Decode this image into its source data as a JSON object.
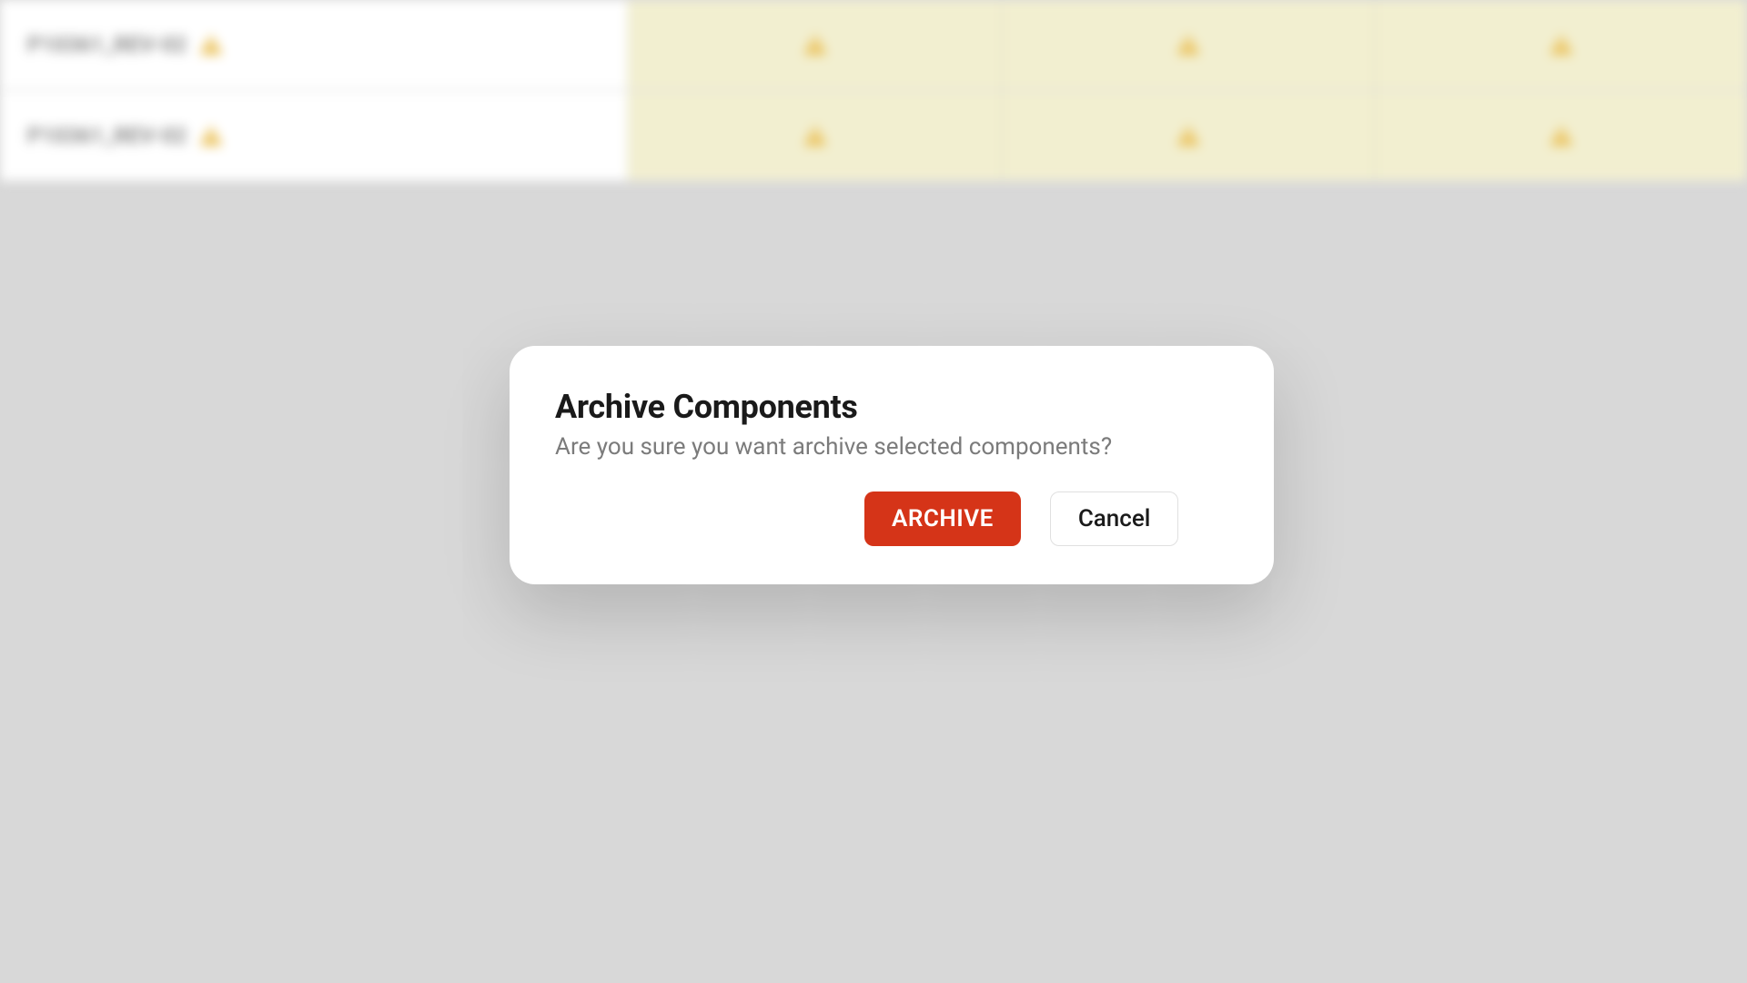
{
  "background": {
    "rows": [
      {
        "label": "P10361_REV-02"
      },
      {
        "label": "P10361_REV-02"
      }
    ]
  },
  "modal": {
    "title": "Archive Components",
    "message": "Are you sure you want archive selected components?",
    "archive_label": "ARCHIVE",
    "cancel_label": "Cancel"
  },
  "colors": {
    "primary_action": "#d53418",
    "warning_icon": "#e8b943"
  }
}
